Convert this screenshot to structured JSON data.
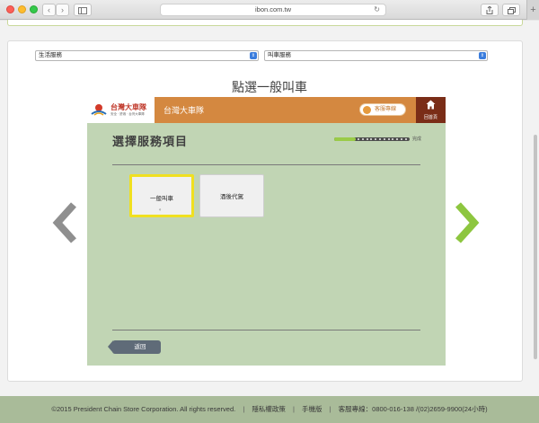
{
  "browser": {
    "url": "ibon.com.tw",
    "back_glyph": "‹",
    "forward_glyph": "›",
    "reload_glyph": "↻",
    "new_tab_glyph": "+"
  },
  "selects": {
    "left_value": "生活服務",
    "right_value": "叫車服務"
  },
  "heading": "點選一般叫車",
  "kiosk": {
    "logo_text": "台灣大車隊",
    "logo_sub": "安全 · 舒適 · 台灣大車隊",
    "header_title": "台灣大車隊",
    "cs_label": "客服專線",
    "home_label": "回首頁",
    "title": "選擇服務項目",
    "progress_label": "完成",
    "progress_fraction": 0.28,
    "options": [
      {
        "label": "一般叫車",
        "sub": "。"
      },
      {
        "label": "酒後代駕",
        "sub": ""
      }
    ],
    "back_label": "返回"
  },
  "colors": {
    "accent_orange": "#d48840",
    "home_brown": "#7a2d17",
    "panel_green": "#c1d5b4",
    "selected_yellow": "#f0e020",
    "arrow_green": "#8dc63f",
    "arrow_gray": "#8f8f8f"
  },
  "footer": {
    "copyright": "©2015 President Chain Store Corporation. All rights reserved.",
    "privacy": "隱私權政策",
    "mobile": "手機版",
    "hotline": "客服專線：0800-016-138 /(02)2659-9900(24小時)"
  }
}
